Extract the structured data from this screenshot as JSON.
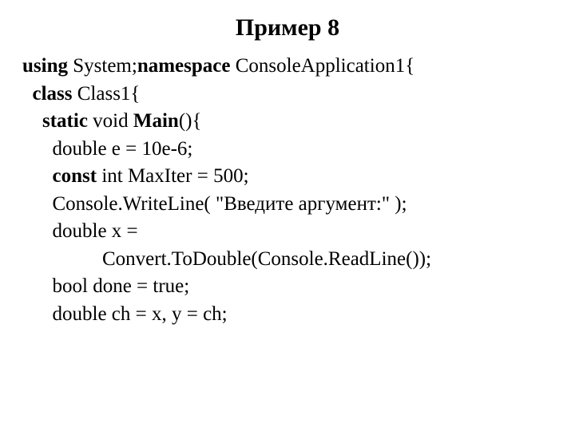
{
  "title": "Пример 8",
  "code": {
    "l1": {
      "t1": "using",
      "t2": " System;",
      "t3": "namespace",
      "t4": " ConsoleApplication1{"
    },
    "l2": {
      "t1": "class",
      "t2": " Class1{"
    },
    "l3": {
      "t1": "static",
      "t2": " void ",
      "t3": "Main",
      "t4": "(){"
    },
    "l4": "double e = 10e-6;",
    "l5": {
      "t1": "const",
      "t2": " int MaxIter = 500;"
    },
    "l6": "Console.WriteLine( \"Введите аргумент:\" );",
    "l7": "double x =",
    "l8": "Convert.ToDouble(Console.ReadLine());",
    "l9": "bool done = true;",
    "l10": "double ch = x, y = ch;"
  }
}
